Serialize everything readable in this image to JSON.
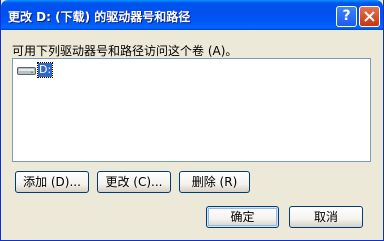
{
  "window": {
    "title": "更改 D: (下载) 的驱动器号和路径",
    "help_label": "?"
  },
  "prompt": "可用下列驱动器号和路径访问这个卷 (A)。",
  "list": {
    "items": [
      {
        "label": "D:",
        "icon": "drive-icon"
      }
    ]
  },
  "buttons": {
    "add": "添加 (D)...",
    "change": "更改 (C)...",
    "delete": "删除 (R)",
    "ok": "确定",
    "cancel": "取消"
  },
  "colors": {
    "titlebar": "#0054e3",
    "selection": "#316ac5",
    "dialog_bg": "#ece9d8"
  }
}
